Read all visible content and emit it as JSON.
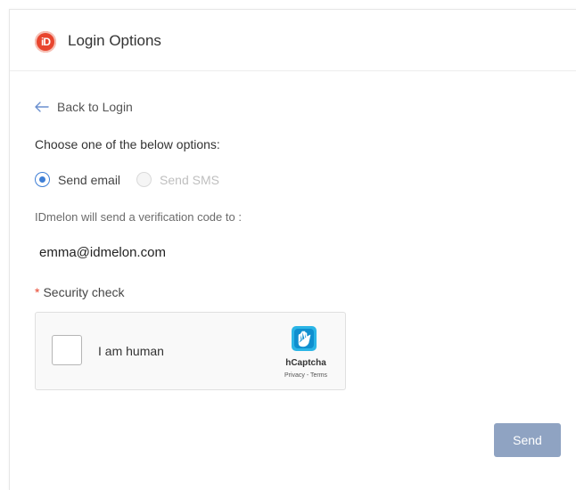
{
  "header": {
    "title": "Login Options",
    "logo_text": "iD",
    "logo_icon": "idmelon-logo-icon"
  },
  "back_link": {
    "label": "Back to Login",
    "icon": "arrow-left-icon"
  },
  "instruction": "Choose one of the below options:",
  "options": [
    {
      "label": "Send email",
      "selected": true,
      "enabled": true
    },
    {
      "label": "Send SMS",
      "selected": false,
      "enabled": false
    }
  ],
  "verification_text": "IDmelon will send a verification code to :",
  "email": "emma@idmelon.com",
  "security": {
    "required_mark": "*",
    "label": "Security check"
  },
  "captcha": {
    "checkbox_label": "I am human",
    "brand": "hCaptcha",
    "links": "Privacy - Terms",
    "checked": false
  },
  "send_button": {
    "label": "Send"
  },
  "colors": {
    "accent": "#3f7fd6",
    "brand": "#e8452e",
    "button": "#8fa3c2",
    "captcha_logo": "#2bb5e6"
  }
}
